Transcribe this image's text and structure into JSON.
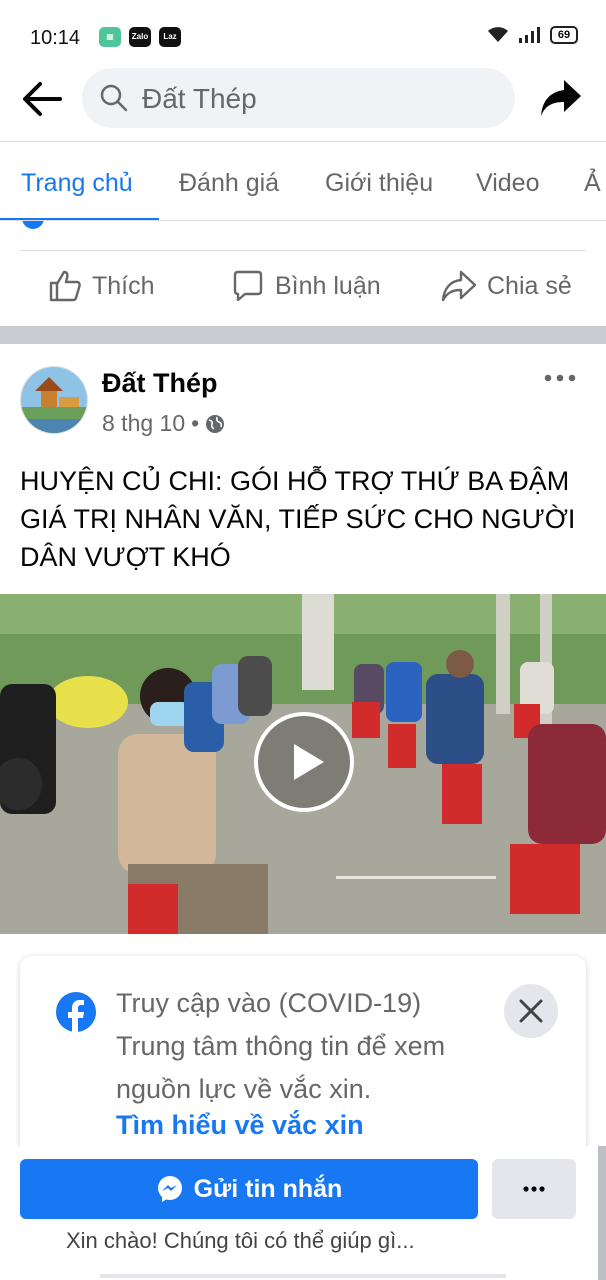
{
  "status_bar": {
    "time": "10:14",
    "app_icons": [
      "Zalo",
      "Laz"
    ],
    "battery": "69"
  },
  "search": {
    "query": "Đất Thép",
    "placeholder": "Đất Thép"
  },
  "tabs": [
    {
      "label": "Trang chủ",
      "active": true
    },
    {
      "label": "Đánh giá",
      "active": false
    },
    {
      "label": "Giới thiệu",
      "active": false
    },
    {
      "label": "Video",
      "active": false
    },
    {
      "label": "Ả",
      "active": false
    }
  ],
  "actions": {
    "like": "Thích",
    "comment": "Bình luận",
    "share": "Chia sẻ"
  },
  "post": {
    "page_name": "Đất Thép",
    "date": "8 thg 10",
    "separator": "•",
    "text": "HUYỆN CỦ CHI: GÓI HỖ TRỢ THỨ BA ĐẬM GIÁ TRỊ NHÂN VĂN, TIẾP SỨC CHO NGƯỜI DÂN VƯỢT KHÓ"
  },
  "covid_card": {
    "text": "Truy cập vào (COVID-19) Trung tâm thông tin để xem nguồn lực về vắc xin.",
    "link": "Tìm hiểu về vắc xin"
  },
  "bottom": {
    "send_label": "Gửi tin nhắn",
    "greeting": "Xin chào! Chúng tôi có thể giúp gì..."
  },
  "colors": {
    "accent": "#1877f2",
    "secondary_text": "#65676b",
    "divider": "#dadde1"
  }
}
